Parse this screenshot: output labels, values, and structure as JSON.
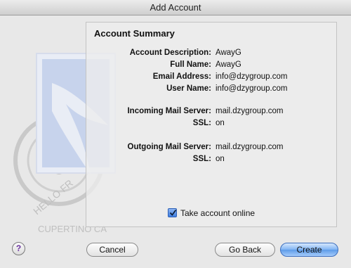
{
  "window": {
    "title": "Add Account"
  },
  "summary": {
    "title": "Account Summary",
    "rows": [
      {
        "label": "Account Description:",
        "value": "AwayG"
      },
      {
        "label": "Full Name:",
        "value": "AwayG"
      },
      {
        "label": "Email Address:",
        "value": "info@dzygroup.com"
      },
      {
        "label": "User Name:",
        "value": "info@dzygroup.com"
      },
      {
        "label": "Incoming Mail Server:",
        "value": "mail.dzygroup.com"
      },
      {
        "label": "SSL:",
        "value": "on"
      },
      {
        "label": "Outgoing Mail Server:",
        "value": "mail.dzygroup.com"
      },
      {
        "label": "SSL:",
        "value": "on"
      }
    ]
  },
  "take_online": {
    "label": "Take account online",
    "checked": true
  },
  "buttons": {
    "help": "?",
    "cancel": "Cancel",
    "go_back": "Go Back",
    "create": "Create"
  },
  "stamp": {
    "text_top": "HELLO FR",
    "text_bottom": "CUPERTINO CA"
  },
  "colors": {
    "accent": "#5d9be8",
    "stamp": "#c7d3ec"
  }
}
